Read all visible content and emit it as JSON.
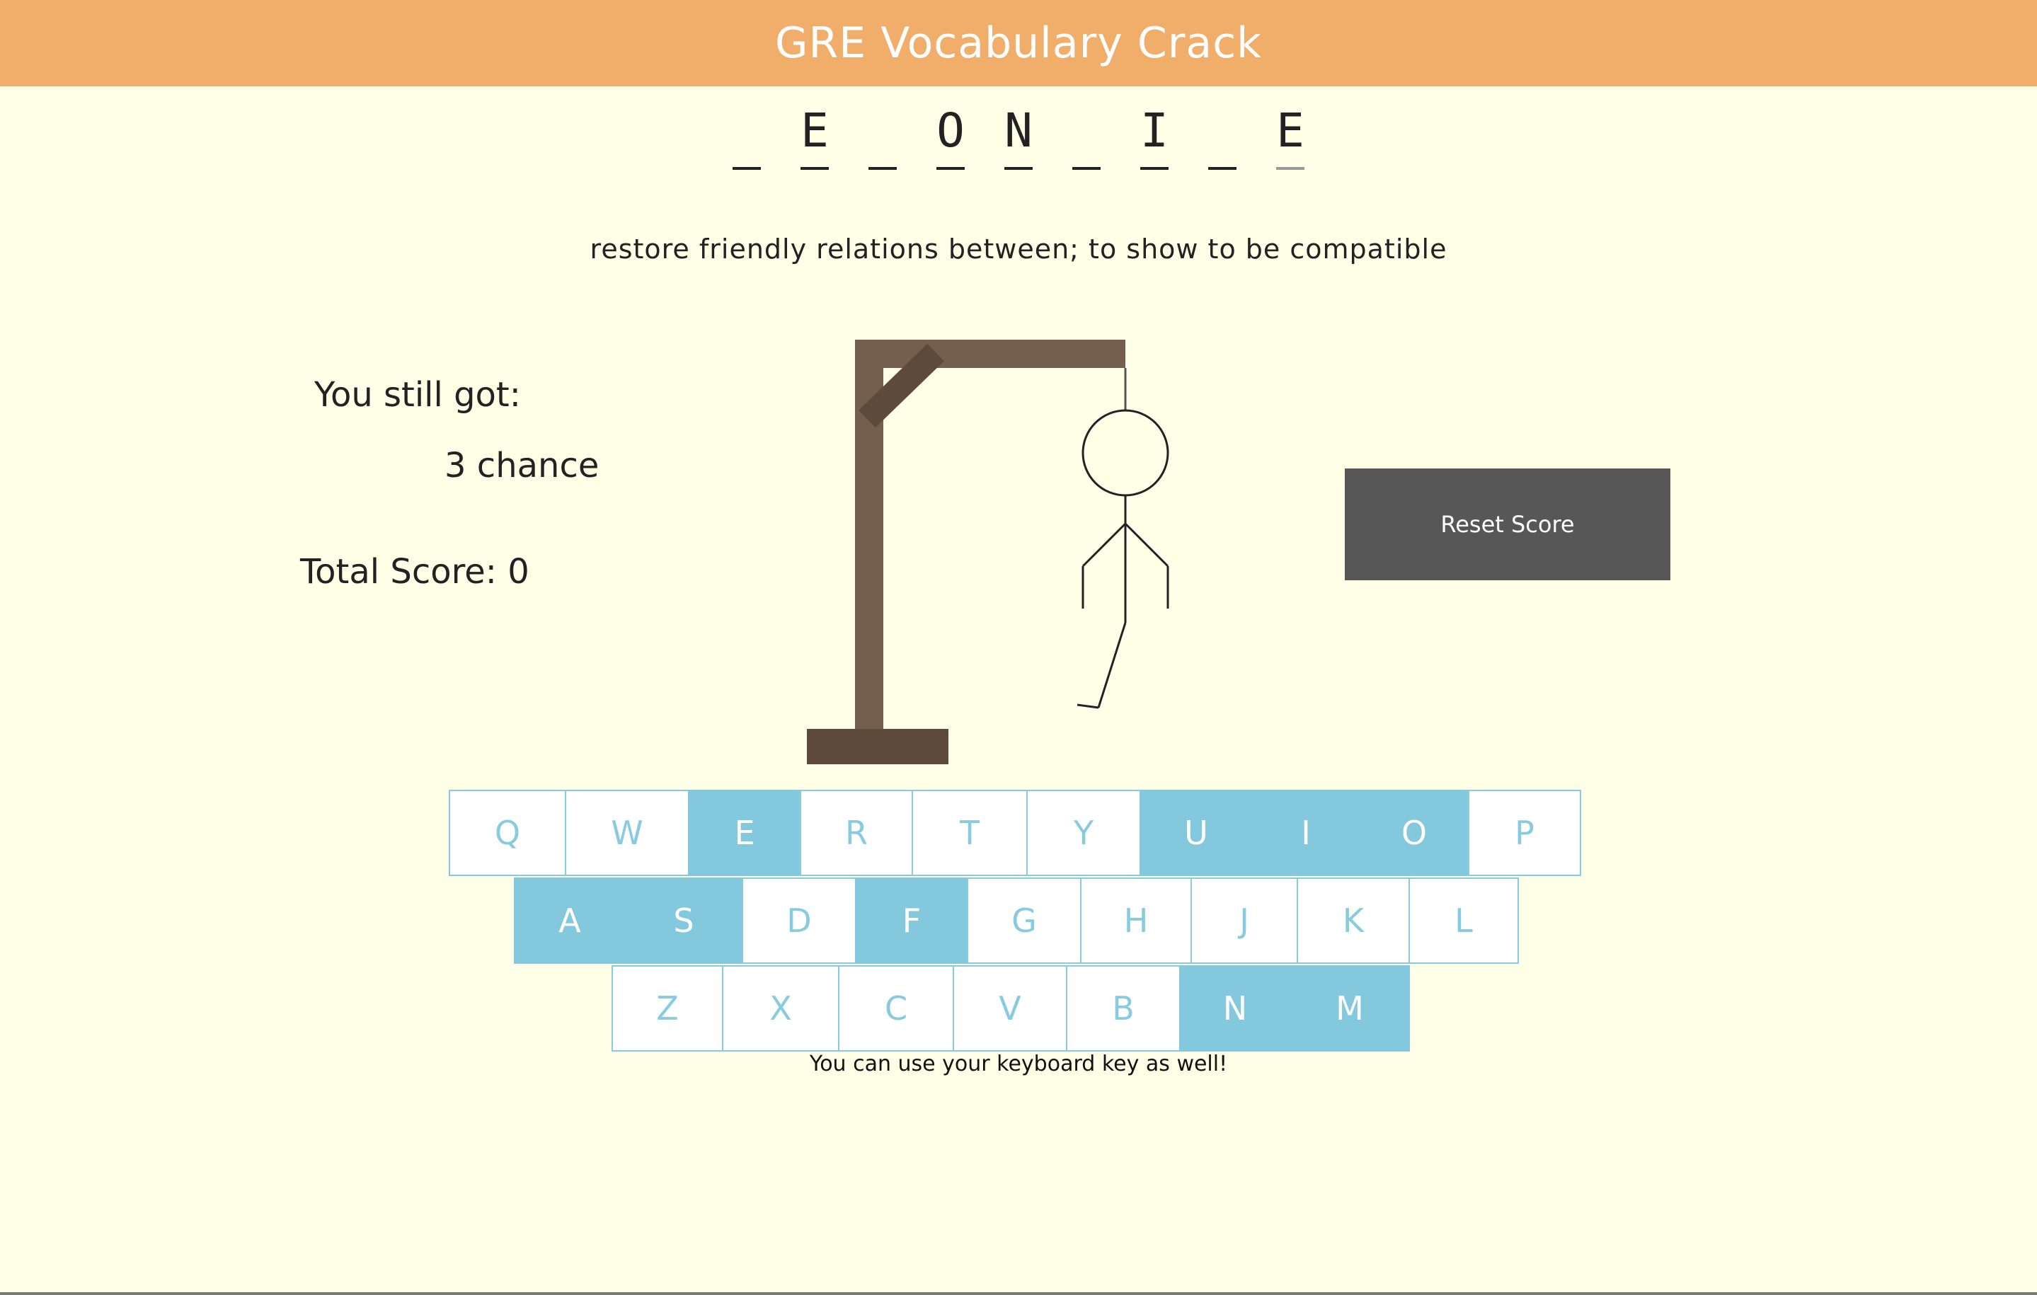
{
  "header": {
    "title": "GRE Vocabulary Crack"
  },
  "word": {
    "letters": [
      "_",
      "E",
      "_",
      "O",
      "N",
      "_",
      "I",
      "_",
      "E"
    ]
  },
  "hint": "restore friendly relations between; to show to be compatible",
  "status": {
    "still_label": "You still got:",
    "chances": "3 chance",
    "score": "Total Score: 0"
  },
  "reset_button": "Reset Score",
  "keyboard": {
    "rows": [
      [
        "Q",
        "W",
        "E",
        "R",
        "T",
        "Y",
        "U",
        "I",
        "O",
        "P"
      ],
      [
        "A",
        "S",
        "D",
        "F",
        "G",
        "H",
        "J",
        "K",
        "L"
      ],
      [
        "Z",
        "X",
        "C",
        "V",
        "B",
        "N",
        "M"
      ]
    ],
    "used": [
      "E",
      "U",
      "I",
      "O",
      "A",
      "S",
      "F",
      "N",
      "M"
    ],
    "note": "You can use your keyboard key as well!"
  },
  "colors": {
    "header": "#f0ae6a",
    "background": "#fffee6",
    "key_used": "#83c8dd",
    "key_border": "#88cbe0",
    "button": "#575757",
    "gallows_post": "#745e4c",
    "gallows_base": "#5e4a3a"
  },
  "icons": [
    "gallows-icon",
    "stick-figure-icon"
  ]
}
